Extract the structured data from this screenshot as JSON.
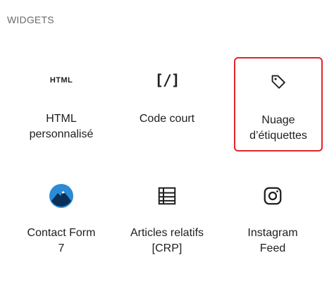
{
  "section": {
    "title": "WIDGETS"
  },
  "blocks": [
    {
      "label": "HTML\npersonnalisé",
      "icon_text": "HTML",
      "icon": "html-icon"
    },
    {
      "label": "Code court",
      "icon_text": "[/]",
      "icon": "shortcode-icon"
    },
    {
      "label": "Nuage\nd’étiquettes",
      "icon": "tag-icon",
      "highlighted": true
    },
    {
      "label": "Contact Form\n7",
      "icon": "contact-form-7-logo-icon"
    },
    {
      "label": "Articles relatifs\n[CRP]",
      "icon": "list-icon"
    },
    {
      "label": "Instagram\nFeed",
      "icon": "instagram-icon"
    }
  ],
  "colors": {
    "highlight_border": "#e0262b",
    "text": "#1e1e1e",
    "section_title": "#6b6b6b",
    "cf7_blue": "#2b8bd6",
    "cf7_dark": "#0b2f57"
  }
}
